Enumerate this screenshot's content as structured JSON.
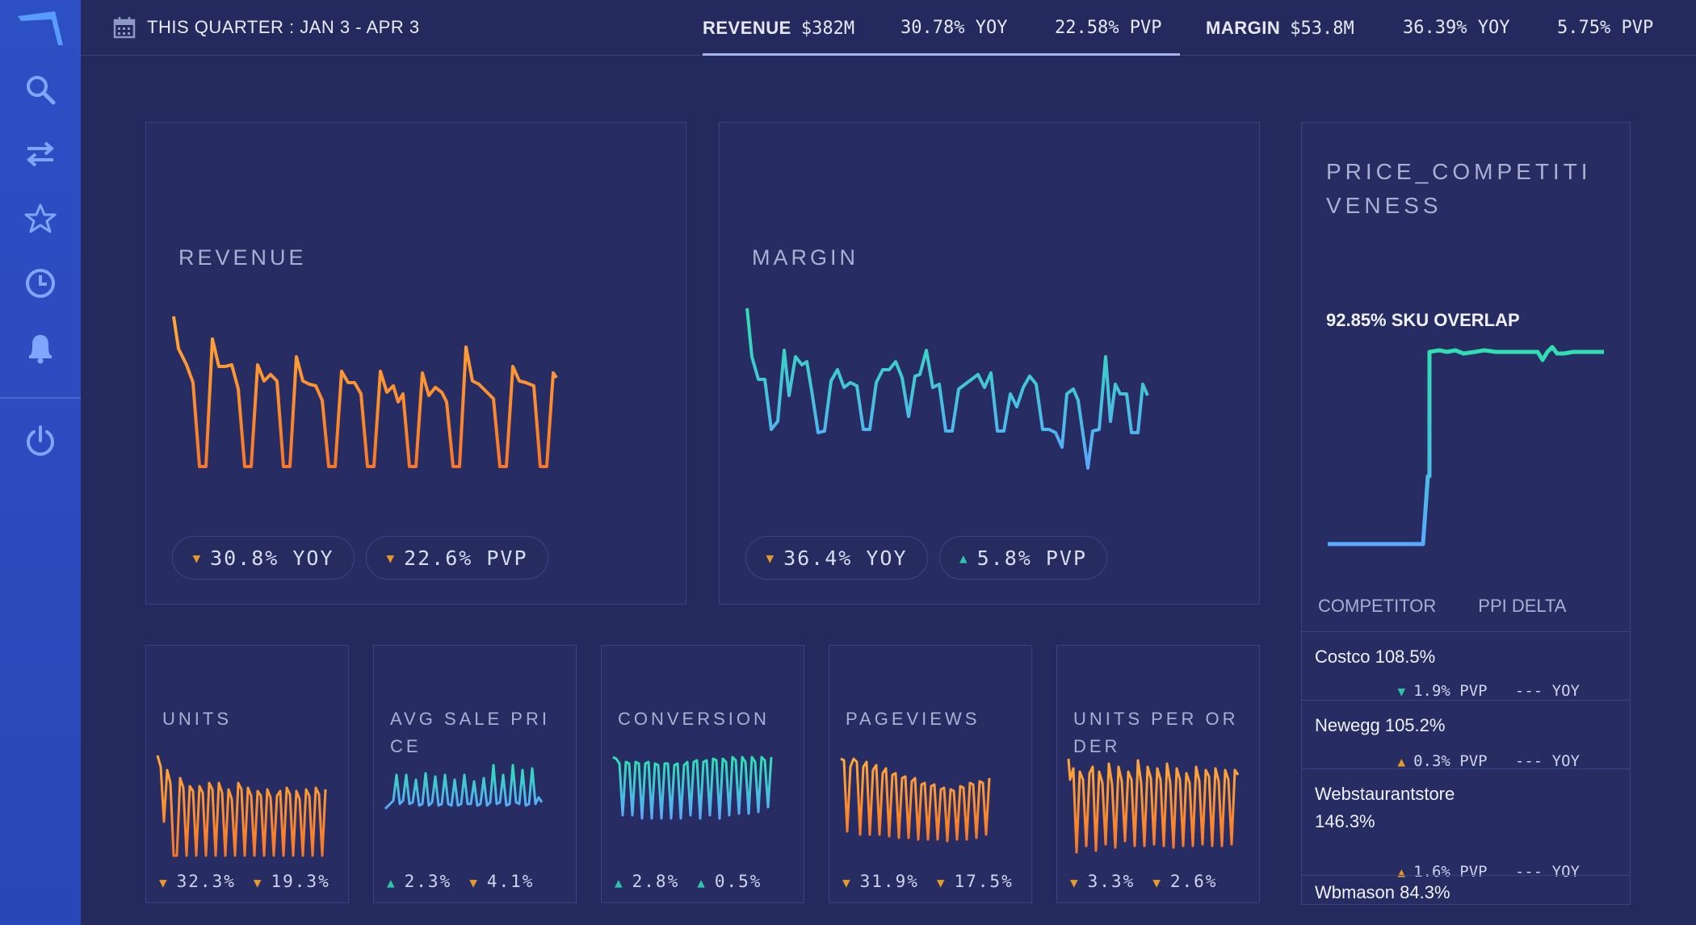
{
  "app": {
    "logo_icon": "boomerang-logo"
  },
  "sidebar": {
    "items": [
      {
        "icon": "search-icon"
      },
      {
        "icon": "swap-arrows-icon"
      },
      {
        "icon": "star-icon"
      },
      {
        "icon": "clock-icon"
      },
      {
        "icon": "bell-icon"
      },
      {
        "icon": "power-icon"
      }
    ]
  },
  "topbar": {
    "date_range": "THIS QUARTER : JAN 3 - APR 3",
    "revenue": {
      "label": "REVENUE",
      "value": "$382M",
      "yoy": "30.78% YOY",
      "pvp": "22.58% PVP"
    },
    "margin": {
      "label": "MARGIN",
      "value": "$53.8M",
      "yoy": "36.39% YOY",
      "pvp": "5.75% PVP"
    }
  },
  "colors": {
    "orange": "#f79a2e",
    "teal": "#2fd7b4",
    "blue": "#5aa8ff",
    "background": "#252a5e"
  },
  "revenue_card": {
    "title": "REVENUE",
    "yoy": "30.8% YOY",
    "yoy_dir": "down",
    "pvp": "22.6% PVP",
    "pvp_dir": "down"
  },
  "margin_card": {
    "title": "MARGIN",
    "yoy": "36.4% YOY",
    "yoy_dir": "down",
    "pvp": "5.8% PVP",
    "pvp_dir": "up"
  },
  "small_cards": [
    {
      "title": "UNITS",
      "a": "32.3%",
      "a_dir": "down",
      "b": "19.3%",
      "b_dir": "down"
    },
    {
      "title": "AVG SALE PRICE",
      "a": "2.3%",
      "a_dir": "up",
      "b": "4.1%",
      "b_dir": "down"
    },
    {
      "title": "CONVERSION",
      "a": "2.8%",
      "a_dir": "up",
      "b": "0.5%",
      "b_dir": "up"
    },
    {
      "title": "PAGEVIEWS",
      "a": "31.9%",
      "a_dir": "down",
      "b": "17.5%",
      "b_dir": "down"
    },
    {
      "title": "UNITS PER ORDER",
      "a": "3.3%",
      "a_dir": "down",
      "b": "2.6%",
      "b_dir": "down"
    }
  ],
  "price_competitiveness": {
    "title": "PRICE_COMPETITIVENESS",
    "sku_overlap": "92.85% SKU OVERLAP",
    "col_competitor": "COMPETITOR",
    "col_delta": "PPI DELTA",
    "competitors": [
      {
        "name": "Costco 108.5%",
        "pvp": "1.9% PVP",
        "pvp_dir": "down",
        "yoy": "--- YOY"
      },
      {
        "name": "Newegg 105.2%",
        "pvp": "0.3% PVP",
        "pvp_dir": "up",
        "yoy": "--- YOY"
      },
      {
        "name": "Webstaurantstore 146.3%",
        "pvp": "1.6% PVP",
        "pvp_dir": "up",
        "yoy": "--- YOY"
      },
      {
        "name": "Wbmason 84.3%",
        "pvp": "",
        "pvp_dir": "",
        "yoy": ""
      }
    ]
  }
}
